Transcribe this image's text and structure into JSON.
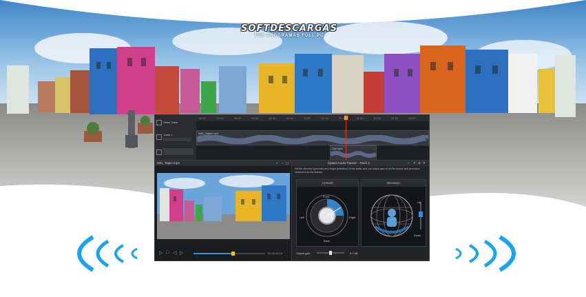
{
  "brand": {
    "name": "SOFTDESCARGAS",
    "tagline": "TUS PROGRAMAS FULL PC"
  },
  "timeline": {
    "ruler_ticks": [
      "00:00",
      "00:10",
      "00:20",
      "00:30",
      "00:40",
      "00:50",
      "01:00",
      "01:10",
      "01:20",
      "01:30",
      "01:40",
      "01:50",
      "02:00"
    ],
    "video_track": {
      "label": "Video Track"
    },
    "track1": {
      "label": "Track 1"
    },
    "clip_main": "IMG_Taipei.mp4",
    "clip_small": "Car.mp3"
  },
  "viewer": {
    "title": "IMG_Taipei.mp4",
    "time": "00:00:06:18",
    "progress": 0.55
  },
  "panner": {
    "title": "Spatial Audio Panner - Track 2",
    "description": "Set the direction (azimuth) and height (elevation) of the audio, and use output gain to set its volume and perceived distance from the listener.",
    "azimuth_title": "Azimuth",
    "elevation_title": "Elevation",
    "front": "Front",
    "back": "Back",
    "left": "Left",
    "right": "Right",
    "up": "Up",
    "down": "Down",
    "output_gain_label": "Output gain",
    "output_gain_value": "0.0 dB",
    "output_gain_level": 0.5,
    "accent": "#2f8fe0"
  },
  "colors": {
    "sound_wave": "#1aa4f0",
    "play_marker": "#f0c020",
    "playhead": "#e03a3a"
  }
}
